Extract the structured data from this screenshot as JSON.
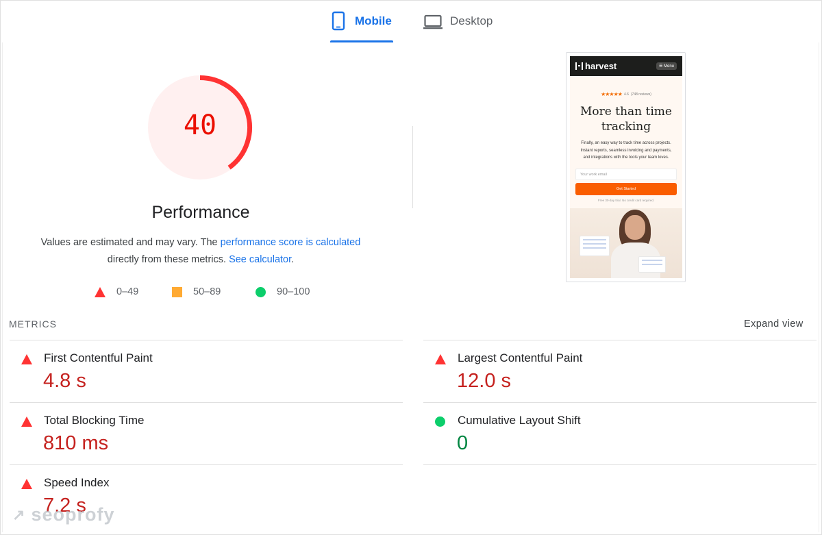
{
  "tabs": [
    {
      "label": "Mobile",
      "icon": "smartphone-icon",
      "active": true
    },
    {
      "label": "Desktop",
      "icon": "laptop-icon",
      "active": false
    }
  ],
  "performance": {
    "score": "40",
    "score_fraction": 0.4,
    "title": "Performance",
    "desc_text1": "Values are estimated and may vary. The ",
    "desc_link1": "performance score is calculated",
    "desc_text2": "directly from these metrics. ",
    "desc_link2": "See calculator",
    "desc_text3": ".",
    "colors": {
      "fail": "#ff3333",
      "fail_bg": "#fff0f0",
      "fail_text": "#c5221f",
      "average": "#ffaa33",
      "pass": "#0cce6b",
      "pass_text": "#018642",
      "accent": "#1a73e8"
    }
  },
  "legend": {
    "fail": "0–49",
    "average": "50–89",
    "pass": "90–100"
  },
  "thumbnail": {
    "logo": "harvest",
    "menu": "☰ Menu",
    "rating_value": "4.6",
    "rating_reviews": "(748 reviews)",
    "headline": "More than time tracking",
    "body": "Finally, an easy way to track time across projects. Instant reports, seamless invoicing and payments, and integrations with the tools your team loves.",
    "input_placeholder": "Your work email",
    "cta": "Get Started",
    "note": "Free 30-day trial. No credit card required."
  },
  "metrics": {
    "header": "METRICS",
    "expand": "Expand view",
    "fcp": {
      "name": "First Contentful Paint",
      "value": "4.8 s",
      "status": "fail"
    },
    "tbt": {
      "name": "Total Blocking Time",
      "value": "810 ms",
      "status": "fail"
    },
    "si": {
      "name": "Speed Index",
      "value": "7.2 s",
      "status": "fail"
    },
    "lcp": {
      "name": "Largest Contentful Paint",
      "value": "12.0 s",
      "status": "fail"
    },
    "cls": {
      "name": "Cumulative Layout Shift",
      "value": "0",
      "status": "pass"
    }
  },
  "watermark": {
    "text": "seoprofy",
    "icon": "arrow-up-right-icon"
  }
}
